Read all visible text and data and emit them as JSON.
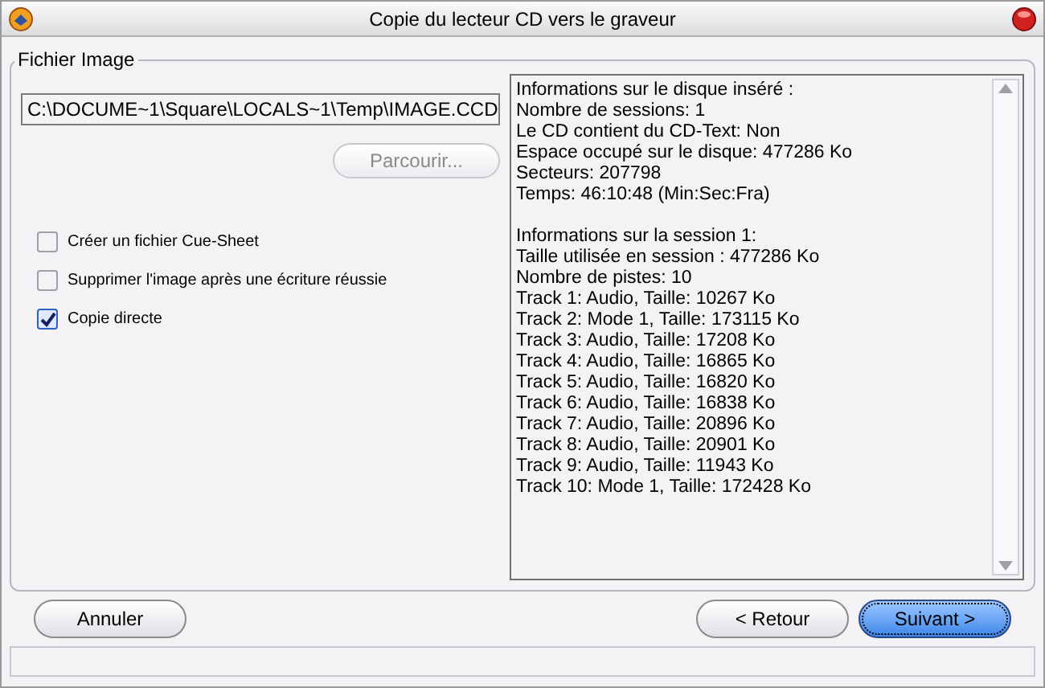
{
  "window": {
    "title": "Copie du lecteur CD vers le graveur"
  },
  "group": {
    "label": "Fichier Image"
  },
  "path_field": {
    "value": "C:\\DOCUME~1\\Square\\LOCALS~1\\Temp\\IMAGE.CCD"
  },
  "browse_button": {
    "label": "Parcourir...",
    "disabled": true
  },
  "options": [
    {
      "label": "Créer un fichier Cue-Sheet",
      "checked": false
    },
    {
      "label": "Supprimer l'image après une écriture réussie",
      "checked": false
    },
    {
      "label": "Copie directe",
      "checked": true
    }
  ],
  "info_blocks": [
    {
      "lines": [
        "Informations sur le disque inséré :",
        "Nombre de sessions: 1",
        "Le CD contient du CD-Text: Non",
        "Espace occupé sur le disque: 477286 Ko",
        "Secteurs: 207798",
        "Temps: 46:10:48 (Min:Sec:Fra)"
      ]
    },
    {
      "lines": [
        "Informations sur la session 1:",
        "Taille utilisée en session : 477286 Ko",
        "Nombre de pistes: 10",
        "Track 1: Audio, Taille: 10267 Ko",
        "Track 2: Mode 1, Taille: 173115 Ko",
        "Track 3: Audio, Taille: 17208 Ko",
        "Track 4: Audio, Taille: 16865 Ko",
        "Track 5: Audio, Taille: 16820 Ko",
        "Track 6: Audio, Taille: 16838 Ko",
        "Track 7: Audio, Taille: 20896 Ko",
        "Track 8: Audio, Taille: 20901 Ko",
        "Track 9: Audio, Taille: 11943 Ko",
        "Track 10: Mode 1, Taille: 172428 Ko"
      ]
    }
  ],
  "buttons": [
    {
      "label": "Annuler",
      "default": false
    },
    {
      "label": "< Retour",
      "default": false
    },
    {
      "label": "Suivant >",
      "default": true
    }
  ]
}
